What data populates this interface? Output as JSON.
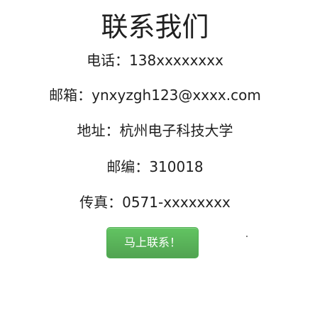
{
  "page": {
    "title": "联系我们"
  },
  "contact": {
    "phone": {
      "label": "电话：",
      "value": "138xxxxxxxx"
    },
    "email": {
      "label": "邮箱：",
      "value": "ynxyzgh123@xxxx.com"
    },
    "address": {
      "label": "地址：",
      "value": "杭州电子科技大学"
    },
    "zip": {
      "label": "邮编：",
      "value": "310018"
    },
    "fax": {
      "label": "传真：",
      "value": "0571-xxxxxxxx"
    }
  },
  "button": {
    "label": "马上联系！",
    "color": "#5cb85c"
  }
}
